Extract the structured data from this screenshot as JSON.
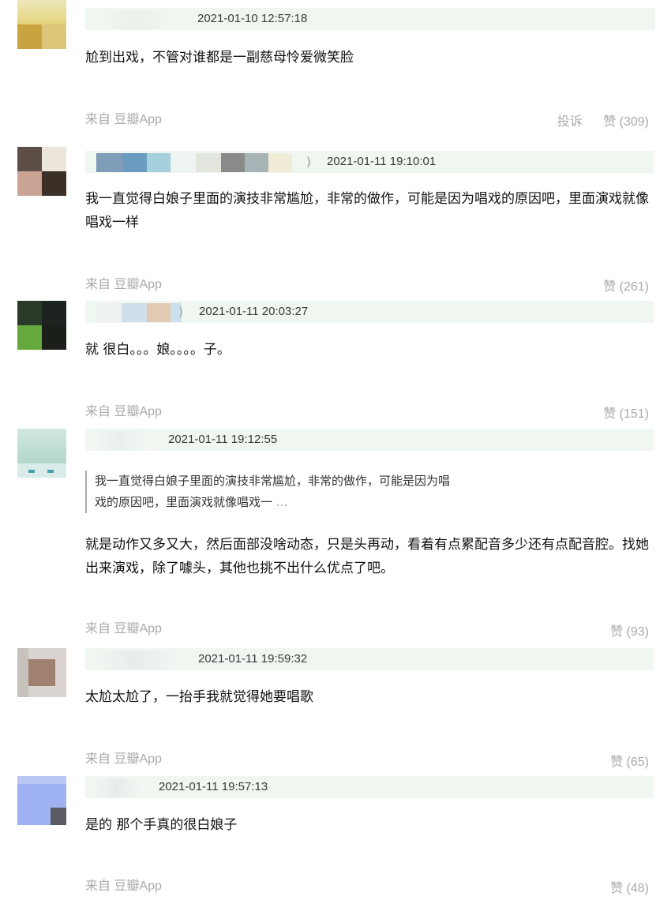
{
  "comments": [
    {
      "time": "2021-01-10 12:57:18",
      "text": "尬到出戏，不管对谁都是一副慈母怜爱微笑脸",
      "source": "来自 豆瓣App",
      "report_label": "投诉",
      "like_label": "赞 (309)"
    },
    {
      "time": "2021-01-11 19:10:01",
      "text": "我一直觉得白娘子里面的演技非常尴尬，非常的做作，可能是因为唱戏的原因吧，里面演戏就像唱戏一样",
      "source": "来自 豆瓣App",
      "like_label": "赞 (261)"
    },
    {
      "time": "2021-01-11 20:03:27",
      "text": "就 很白。。。娘。。。。子。",
      "source": "来自 豆瓣App",
      "like_label": "赞 (151)"
    },
    {
      "time": "2021-01-11 19:12:55",
      "quote_line1": "我一直觉得白娘子里面的演技非常尴尬，非常的做作，可能是因为唱",
      "quote_line2": "戏的原因吧，里面演戏就像唱戏一",
      "quote_more": "...",
      "text": "就是动作又多又大，然后面部没啥动态，只是头再动，看着有点累配音多少还有点配音腔。找她出来演戏，除了噱头，其他也挑不出什么优点了吧。",
      "source": "来自 豆瓣App",
      "like_label": "赞 (93)"
    },
    {
      "time": "2021-01-11 19:59:32",
      "text": "太尬太尬了，一抬手我就觉得她要唱歌",
      "source": "来自 豆瓣App",
      "like_label": "赞 (65)"
    },
    {
      "time": "2021-01-11 19:57:13",
      "text": "是的 那个手真的很白娘子",
      "source": "来自 豆瓣App",
      "like_label": "赞 (48)"
    }
  ],
  "colors": {
    "meta_bar": "#f0f6f0",
    "muted_text": "#aaaaaa"
  }
}
